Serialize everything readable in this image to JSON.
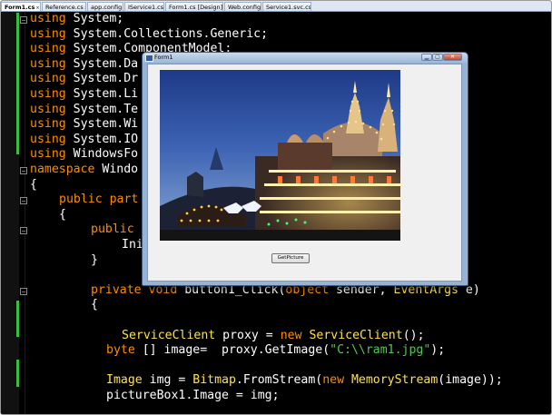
{
  "editor": {
    "tabs": [
      {
        "label": "Form1.cs"
      },
      {
        "label": "Reference.cs"
      },
      {
        "label": "app.config"
      },
      {
        "label": "IService1.cs"
      },
      {
        "label": "Form1.cs [Design]"
      },
      {
        "label": "Web.config"
      },
      {
        "label": "Service1.svc.cs"
      }
    ],
    "tab_close_glyph": "×",
    "fold_minus": "−",
    "code": {
      "l1": [
        "using",
        " System;"
      ],
      "l2": [
        "using",
        " System.Collections.Generic;"
      ],
      "l3": [
        "using",
        " System.ComponentModel;"
      ],
      "l4": [
        "using",
        " System.Da"
      ],
      "l5": [
        "using",
        " System.Dr"
      ],
      "l6": [
        "using",
        " System.Li"
      ],
      "l7": [
        "using",
        " System.Te"
      ],
      "l8": [
        "using",
        " System.Wi"
      ],
      "l9": [
        "using",
        " System.IO"
      ],
      "l10": [
        "using",
        " WindowsFo"
      ],
      "l11": [
        "namespace",
        " Windo"
      ],
      "l12": "{",
      "l13": [
        "public",
        " ",
        "part"
      ],
      "l14": "{",
      "l15": [
        "public",
        " "
      ],
      "l16": "Ini",
      "l17": "}",
      "l18": [
        "private",
        " ",
        "void",
        " button1_Click(",
        "object",
        " sender, ",
        "EventArgs",
        " e)"
      ],
      "l19": "{",
      "l20": [
        "ServiceClient",
        " proxy = ",
        "new",
        " ",
        "ServiceClient",
        "();"
      ],
      "l21": [
        "byte",
        " [] image=  proxy.GetImage(",
        "\"C:\\\\ram1.jpg\"",
        ");"
      ],
      "l22": [
        "Image",
        " img = ",
        "Bitmap",
        ".FromStream(",
        "new",
        " ",
        "MemoryStream",
        "(image));"
      ],
      "l23": "pictureBox1.Image = img;"
    }
  },
  "form": {
    "title": "Form1",
    "min_glyph": "▁",
    "max_glyph": "▢",
    "close_glyph": "✕",
    "button_label": "GetPicture"
  },
  "colors": {
    "keyword": "#ff8c00",
    "type": "#ffe24a",
    "string": "#56c456",
    "background": "#000000"
  }
}
